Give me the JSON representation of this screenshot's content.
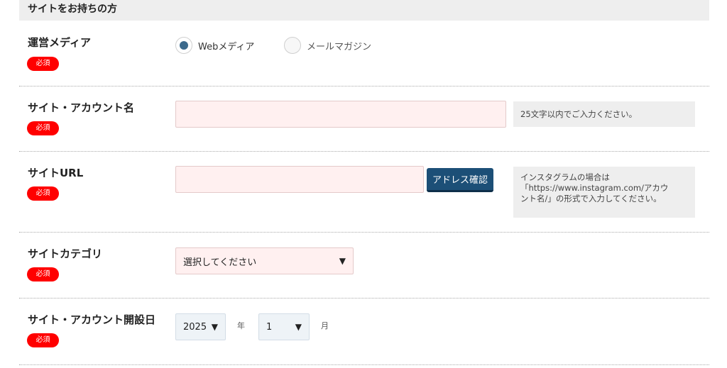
{
  "section_title": "サイトをお持ちの方",
  "required_badge": "必須",
  "media": {
    "label": "運営メディア",
    "options": [
      {
        "label": "Webメディア",
        "selected": true
      },
      {
        "label": "メールマガジン",
        "selected": false
      }
    ]
  },
  "site_name": {
    "label": "サイト・アカウント名",
    "value": "",
    "note": "25文字以内でご入力ください。"
  },
  "site_url": {
    "label": "サイトURL",
    "value": "",
    "button": "アドレス確認",
    "note_lines": [
      "インスタグラムの場合は",
      "「https://www.instagram.com/アカウ",
      "ント名/」の形式で入力してください。"
    ]
  },
  "category": {
    "label": "サイトカテゴリ",
    "selected": "選択してください"
  },
  "opened": {
    "label": "サイト・アカウント開設日",
    "year": "2025",
    "year_unit": "年",
    "month": "1",
    "month_unit": "月"
  },
  "colors": {
    "required": "#ff0000",
    "accent": "#1c4f77",
    "input_bg": "#fff0f0"
  }
}
